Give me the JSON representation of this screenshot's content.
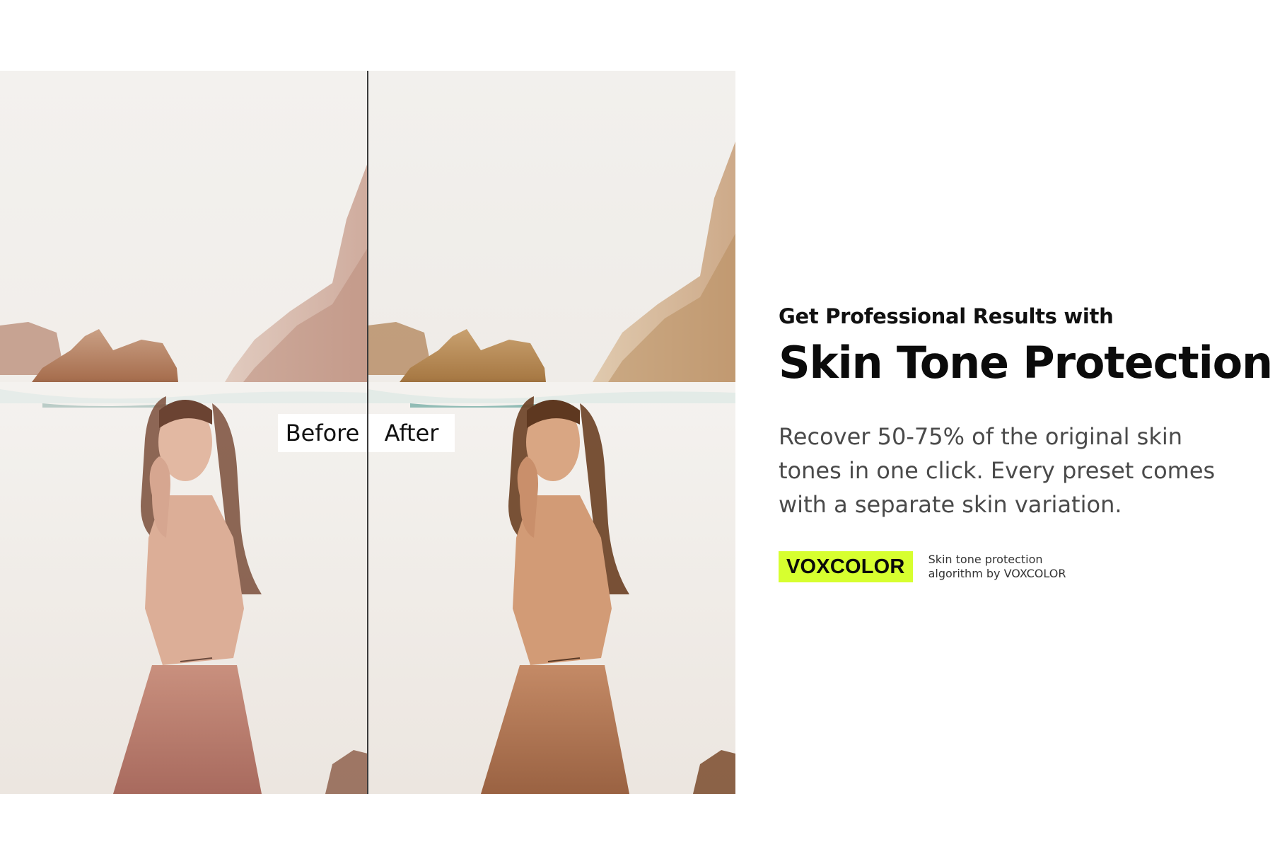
{
  "comparison": {
    "before_label": "Before",
    "after_label": "After"
  },
  "copy": {
    "eyebrow": "Get Professional Results with",
    "headline": "Skin Tone Protection",
    "body": "Recover 50-75% of the original skin tones in one click.  Every preset comes with a separate skin variation.",
    "brand_badge": "VOXCOLOR",
    "brand_caption": "Skin tone protection algorithm by VOXCOLOR"
  },
  "colors": {
    "brand_accent": "#d7ff2f",
    "headline": "#0b0b0b",
    "body": "#4a4a4a"
  }
}
